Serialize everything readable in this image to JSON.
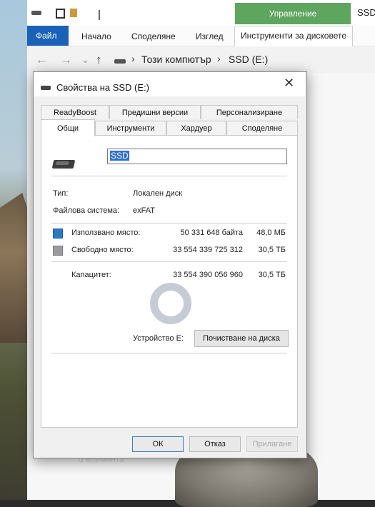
{
  "explorer": {
    "tab_title": "SSD",
    "ribbon": {
      "manage_label": "Управление",
      "tabs": [
        "Файл",
        "Начало",
        "Споделяне",
        "Изглед",
        "Инструменти за дисковете"
      ]
    },
    "address": {
      "back_icon": "←",
      "forward_icon": "→",
      "history_icon": "⌄",
      "up_icon": "↑",
      "sep": "›",
      "crumbs": [
        "Този компютър",
        "SSD (E:)"
      ]
    },
    "status_text": "0 елемента"
  },
  "dialog": {
    "title": "Свойства на SSD (E:)",
    "close_icon": "✕",
    "tabs_back": [
      "ReadyBoost",
      "Предишни версии",
      "Персонализиране"
    ],
    "tabs_front": [
      "Общи",
      "Инструменти",
      "Хардуер",
      "Споделяне"
    ],
    "selected_tab": "Общи",
    "name_value": "SSD",
    "type_label": "Тип:",
    "type_value": "Локален диск",
    "fs_label": "Файлова система:",
    "fs_value": "exFAT",
    "used_label": "Използвано място:",
    "used_bytes": "50 331 648 байта",
    "used_short": "48,0 МБ",
    "free_label": "Свободно място:",
    "free_bytes": "33 554 339 725 312",
    "free_short": "30,5 ТБ",
    "capacity_label": "Капацитет:",
    "capacity_bytes": "33 554 390 056 960",
    "capacity_short": "30,5 ТБ",
    "device_label": "Устройство E:",
    "cleanup_label": "Почистване на диска",
    "ok_label": "ОК",
    "cancel_label": "Отказ",
    "apply_label": "Прилагане",
    "colors": {
      "used": "#2a79c6",
      "free": "#9b9ba3"
    }
  }
}
